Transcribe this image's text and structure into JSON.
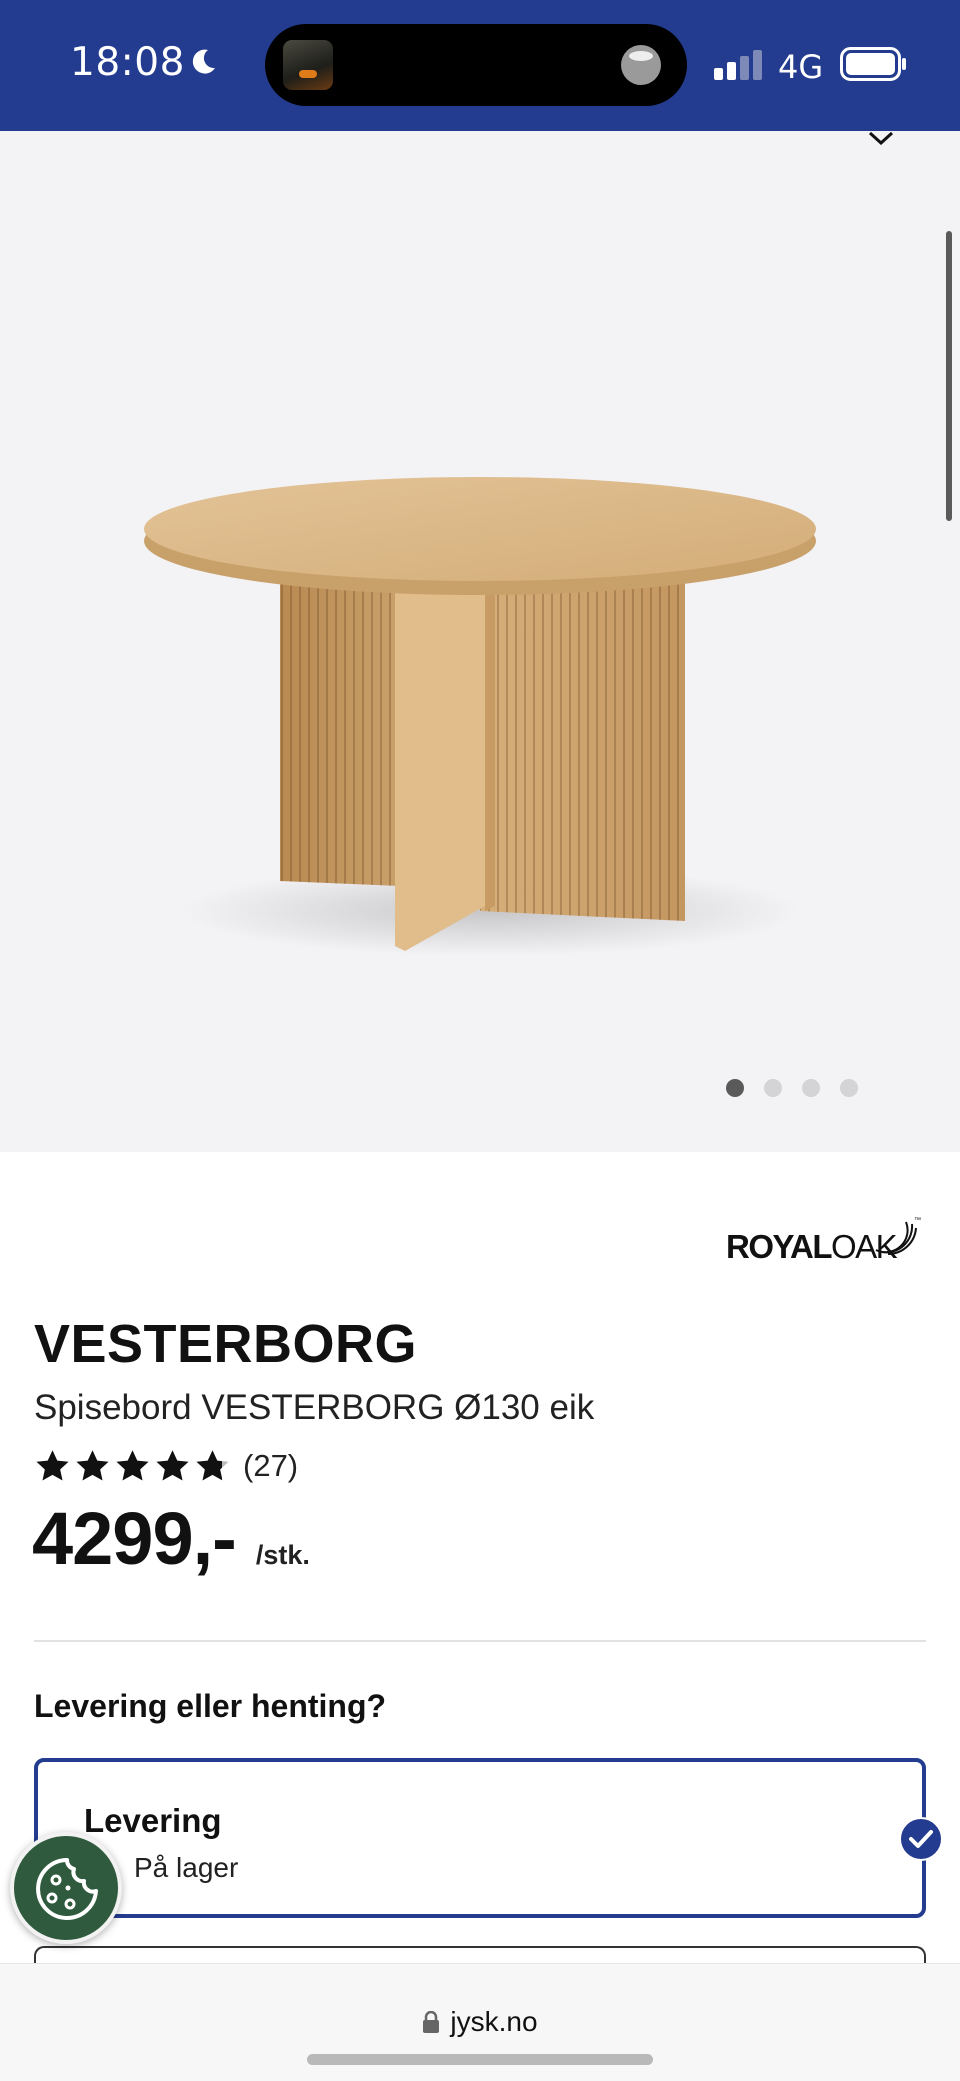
{
  "status_bar": {
    "time": "18:08",
    "network": "4G",
    "icons": [
      "moon-icon",
      "signal-icon",
      "battery-icon"
    ]
  },
  "gallery": {
    "image_description_icon": "round-oak-dining-table",
    "current_slide": 1,
    "total_slides": 4
  },
  "product": {
    "brand": "ROYALOAK",
    "name": "VESTERBORG",
    "description": "Spisebord VESTERBORG Ø130 eik",
    "rating": 4.8,
    "review_count": "(27)",
    "price": "4299,-",
    "price_unit": "/stk."
  },
  "delivery": {
    "heading": "Levering eller henting?",
    "options": [
      {
        "title": "Levering",
        "status": "På lager",
        "selected": true
      }
    ]
  },
  "browser": {
    "url": "jysk.no"
  },
  "colors": {
    "brand_blue": "#233c8f",
    "cookie_green": "#2f5a3d",
    "gallery_bg": "#f3f2f5"
  }
}
